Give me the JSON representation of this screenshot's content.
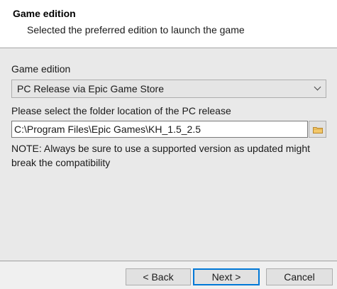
{
  "header": {
    "title": "Game edition",
    "subtitle": "Selected the preferred edition to launch the game"
  },
  "form": {
    "edition_label": "Game edition",
    "edition_selected": "PC Release via Epic Game Store",
    "folder_label": "Please select the folder location of the PC release",
    "folder_path": "C:\\Program Files\\Epic Games\\KH_1.5_2.5",
    "browse_icon": "folder-icon",
    "note": "NOTE: Always be sure to use a supported version as updated might break the compatibility"
  },
  "footer": {
    "back_label": "< Back",
    "next_label": "Next >",
    "cancel_label": "Cancel"
  },
  "colors": {
    "focus_accent": "#0078d7",
    "folder_icon": "#e8b04a"
  }
}
